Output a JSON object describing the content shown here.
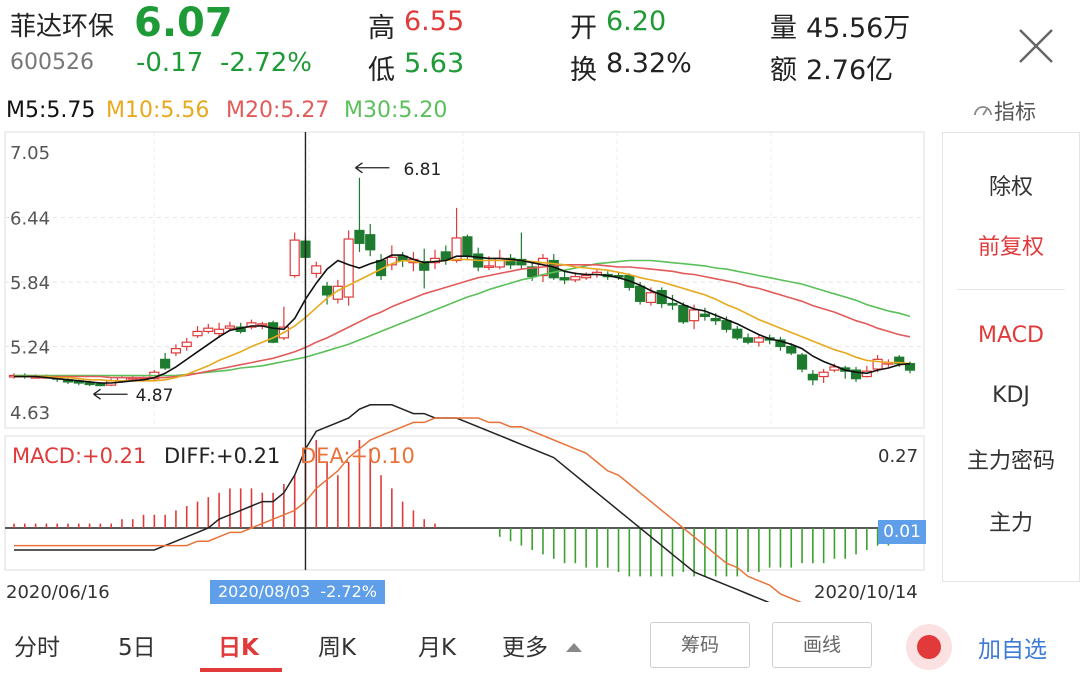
{
  "stock": {
    "name": "菲达环保",
    "code": "600526",
    "price": "6.07",
    "change": "-0.17",
    "change_pct": "-2.72%",
    "high_label": "高",
    "high": "6.55",
    "low_label": "低",
    "low": "5.63",
    "open_label": "开",
    "open": "6.20",
    "turnover_label": "换",
    "turnover": "8.32%",
    "volume_label": "量",
    "volume": "45.56万",
    "amount_label": "额",
    "amount": "2.76亿"
  },
  "ma": {
    "m5": "M5:5.75",
    "m10": "M10:5.56",
    "m20": "M20:5.27",
    "m30": "M30:5.20",
    "indicator_label": "指标"
  },
  "right_panel": {
    "items": [
      "除权",
      "前复权",
      "MACD",
      "KDJ",
      "主力密码",
      "主力"
    ],
    "active": [
      "前复权",
      "MACD"
    ]
  },
  "macd": {
    "macd_label": "MACD:+0.21",
    "diff_label": "DIFF:+0.21",
    "dea_label": "DEA:+0.10",
    "top_value": "0.27",
    "zero_badge": "0.01"
  },
  "dates": {
    "start": "2020/06/16",
    "end": "2020/10/14",
    "cursor_date": "2020/08/03",
    "cursor_pct": "-2.72%"
  },
  "bottom_tabs": [
    "分时",
    "5日",
    "日K",
    "周K",
    "月K",
    "更多"
  ],
  "bottom_active_tab": "日K",
  "bottom_buttons": {
    "chip": "筹码",
    "draw": "画线",
    "add": "加自选"
  },
  "colors": {
    "up": "#e03a3a",
    "down": "#1e7a2e",
    "ma5": "#111111",
    "ma10": "#e8a91e",
    "ma20": "#e25a5a",
    "ma30": "#5bc05a",
    "accent_blue": "#3d7ad6"
  },
  "chart_data": {
    "type": "candlestick",
    "y_ticks": [
      "7.05",
      "6.44",
      "5.84",
      "5.24",
      "4.63"
    ],
    "ylim": [
      4.63,
      7.05
    ],
    "max_annotation": "6.81",
    "min_annotation": "4.87",
    "candles": [
      [
        4.96,
        4.97,
        4.99,
        4.94
      ],
      [
        4.97,
        4.96,
        4.99,
        4.94
      ],
      [
        4.96,
        4.96,
        4.98,
        4.94
      ],
      [
        4.96,
        4.96,
        4.98,
        4.94
      ],
      [
        4.95,
        4.94,
        4.97,
        4.91
      ],
      [
        4.93,
        4.91,
        4.95,
        4.89
      ],
      [
        4.92,
        4.9,
        4.93,
        4.88
      ],
      [
        4.9,
        4.89,
        4.92,
        4.87
      ],
      [
        4.89,
        4.88,
        4.91,
        4.87
      ],
      [
        4.88,
        4.92,
        4.94,
        4.87
      ],
      [
        4.92,
        4.95,
        4.97,
        4.9
      ],
      [
        4.94,
        4.95,
        4.97,
        4.92
      ],
      [
        4.94,
        4.94,
        4.96,
        4.92
      ],
      [
        4.94,
        5.0,
        5.02,
        4.93
      ],
      [
        5.12,
        5.04,
        5.18,
        5.02
      ],
      [
        5.18,
        5.22,
        5.26,
        5.15
      ],
      [
        5.24,
        5.28,
        5.32,
        5.2
      ],
      [
        5.34,
        5.38,
        5.43,
        5.32
      ],
      [
        5.38,
        5.41,
        5.45,
        5.36
      ],
      [
        5.36,
        5.4,
        5.46,
        5.32
      ],
      [
        5.41,
        5.43,
        5.47,
        5.38
      ],
      [
        5.42,
        5.38,
        5.46,
        5.36
      ],
      [
        5.42,
        5.46,
        5.49,
        5.4
      ],
      [
        5.45,
        5.45,
        5.47,
        5.4
      ],
      [
        5.46,
        5.28,
        5.48,
        5.27
      ],
      [
        5.32,
        5.42,
        5.61,
        5.3
      ],
      [
        5.9,
        6.23,
        6.3,
        5.88
      ],
      [
        6.22,
        6.07,
        6.26,
        5.63
      ],
      [
        5.92,
        5.99,
        6.03,
        5.88
      ],
      [
        5.8,
        5.72,
        5.84,
        5.63
      ],
      [
        5.68,
        5.8,
        5.86,
        5.64
      ],
      [
        5.7,
        6.24,
        6.32,
        5.62
      ],
      [
        6.32,
        6.2,
        6.81,
        6.12
      ],
      [
        6.28,
        6.14,
        6.38,
        6.08
      ],
      [
        6.04,
        5.9,
        6.1,
        5.86
      ],
      [
        6.0,
        6.07,
        6.18,
        5.95
      ],
      [
        6.08,
        6.04,
        6.12,
        5.98
      ],
      [
        6.02,
        6.05,
        6.12,
        5.94
      ],
      [
        6.03,
        5.95,
        6.15,
        5.78
      ],
      [
        6.02,
        6.06,
        6.14,
        5.96
      ],
      [
        6.12,
        6.05,
        6.18,
        6.0
      ],
      [
        6.04,
        6.25,
        6.53,
        6.02
      ],
      [
        6.26,
        6.08,
        6.28,
        6.04
      ],
      [
        6.1,
        5.98,
        6.16,
        5.94
      ],
      [
        5.99,
        5.99,
        6.08,
        5.95
      ],
      [
        5.98,
        6.06,
        6.14,
        5.96
      ],
      [
        6.06,
        6.0,
        6.1,
        5.96
      ],
      [
        6.05,
        6.0,
        6.3,
        5.96
      ],
      [
        5.98,
        5.89,
        6.02,
        5.85
      ],
      [
        5.9,
        6.06,
        6.1,
        5.84
      ],
      [
        6.04,
        5.88,
        6.1,
        5.86
      ],
      [
        5.88,
        5.86,
        5.95,
        5.82
      ],
      [
        5.86,
        5.89,
        5.93,
        5.84
      ],
      [
        5.88,
        5.9,
        5.93,
        5.86
      ],
      [
        5.91,
        5.93,
        5.96,
        5.88
      ],
      [
        5.91,
        5.89,
        5.94,
        5.86
      ],
      [
        5.9,
        5.89,
        5.93,
        5.86
      ],
      [
        5.9,
        5.79,
        5.92,
        5.76
      ],
      [
        5.8,
        5.66,
        5.84,
        5.63
      ],
      [
        5.65,
        5.74,
        5.79,
        5.62
      ],
      [
        5.76,
        5.64,
        5.79,
        5.6
      ],
      [
        5.64,
        5.63,
        5.72,
        5.58
      ],
      [
        5.62,
        5.47,
        5.65,
        5.45
      ],
      [
        5.48,
        5.58,
        5.63,
        5.4
      ],
      [
        5.54,
        5.52,
        5.6,
        5.48
      ],
      [
        5.5,
        5.48,
        5.55,
        5.44
      ],
      [
        5.48,
        5.4,
        5.52,
        5.37
      ],
      [
        5.4,
        5.32,
        5.43,
        5.3
      ],
      [
        5.32,
        5.28,
        5.36,
        5.26
      ],
      [
        5.28,
        5.32,
        5.35,
        5.24
      ],
      [
        5.32,
        5.3,
        5.35,
        5.26
      ],
      [
        5.3,
        5.24,
        5.33,
        5.2
      ],
      [
        5.24,
        5.18,
        5.27,
        5.16
      ],
      [
        5.16,
        5.03,
        5.18,
        5.0
      ],
      [
        4.98,
        4.93,
        5.02,
        4.88
      ],
      [
        4.96,
        5.0,
        5.03,
        4.9
      ],
      [
        5.02,
        5.05,
        5.08,
        5.0
      ],
      [
        5.04,
        5.01,
        5.06,
        4.94
      ],
      [
        5.02,
        4.94,
        5.05,
        4.91
      ],
      [
        4.96,
        5.01,
        5.06,
        4.95
      ],
      [
        5.03,
        5.12,
        5.16,
        5.0
      ],
      [
        5.08,
        5.09,
        5.12,
        5.05
      ],
      [
        5.14,
        5.08,
        5.16,
        5.05
      ],
      [
        5.08,
        5.02,
        5.1,
        4.99
      ]
    ],
    "ma5": [
      4.96,
      4.96,
      4.96,
      4.95,
      4.94,
      4.93,
      4.92,
      4.91,
      4.9,
      4.9,
      4.91,
      4.92,
      4.93,
      4.95,
      4.99,
      5.05,
      5.12,
      5.19,
      5.26,
      5.33,
      5.39,
      5.41,
      5.43,
      5.43,
      5.41,
      5.4,
      5.5,
      5.68,
      5.83,
      5.96,
      6.04,
      6.0,
      5.97,
      6.01,
      6.04,
      6.09,
      6.09,
      6.05,
      6.02,
      6.03,
      6.04,
      6.08,
      6.08,
      6.07,
      6.06,
      6.06,
      6.05,
      6.04,
      6.02,
      6.0,
      5.98,
      5.94,
      5.92,
      5.91,
      5.91,
      5.9,
      5.88,
      5.85,
      5.81,
      5.76,
      5.72,
      5.68,
      5.63,
      5.59,
      5.57,
      5.53,
      5.49,
      5.45,
      5.4,
      5.35,
      5.31,
      5.29,
      5.26,
      5.22,
      5.15,
      5.1,
      5.06,
      5.02,
      5.0,
      4.99,
      5.02,
      5.04,
      5.07,
      5.08
    ],
    "ma10": [
      4.96,
      4.96,
      4.96,
      4.96,
      4.95,
      4.95,
      4.94,
      4.93,
      4.93,
      4.92,
      4.92,
      4.92,
      4.92,
      4.92,
      4.93,
      4.95,
      4.98,
      5.02,
      5.06,
      5.11,
      5.15,
      5.19,
      5.24,
      5.28,
      5.32,
      5.37,
      5.43,
      5.51,
      5.6,
      5.69,
      5.76,
      5.81,
      5.86,
      5.91,
      5.96,
      6.01,
      6.04,
      6.03,
      6.02,
      6.03,
      6.04,
      6.05,
      6.05,
      6.04,
      6.04,
      6.04,
      6.04,
      6.04,
      6.03,
      6.02,
      6.01,
      6.0,
      5.98,
      5.97,
      5.96,
      5.95,
      5.93,
      5.91,
      5.88,
      5.86,
      5.84,
      5.81,
      5.78,
      5.75,
      5.72,
      5.68,
      5.63,
      5.59,
      5.54,
      5.49,
      5.45,
      5.41,
      5.37,
      5.33,
      5.29,
      5.25,
      5.21,
      5.18,
      5.14,
      5.11,
      5.1,
      5.09,
      5.09,
      5.08
    ],
    "ma20": [
      4.96,
      4.96,
      4.96,
      4.96,
      4.96,
      4.96,
      4.96,
      4.96,
      4.96,
      4.95,
      4.95,
      4.95,
      4.95,
      4.95,
      4.95,
      4.96,
      4.97,
      4.99,
      5.01,
      5.03,
      5.05,
      5.07,
      5.09,
      5.11,
      5.13,
      5.16,
      5.19,
      5.23,
      5.28,
      5.32,
      5.37,
      5.42,
      5.47,
      5.52,
      5.56,
      5.61,
      5.65,
      5.69,
      5.73,
      5.76,
      5.79,
      5.82,
      5.85,
      5.88,
      5.9,
      5.92,
      5.94,
      5.96,
      5.97,
      5.98,
      5.99,
      6.0,
      6.0,
      6.0,
      6.0,
      5.99,
      5.98,
      5.98,
      5.97,
      5.96,
      5.95,
      5.94,
      5.92,
      5.91,
      5.89,
      5.87,
      5.85,
      5.83,
      5.8,
      5.78,
      5.75,
      5.72,
      5.69,
      5.66,
      5.62,
      5.59,
      5.56,
      5.52,
      5.48,
      5.45,
      5.41,
      5.38,
      5.35,
      5.33
    ],
    "ma30": [
      4.97,
      4.97,
      4.97,
      4.97,
      4.97,
      4.97,
      4.97,
      4.97,
      4.97,
      4.97,
      4.97,
      4.97,
      4.97,
      4.97,
      4.97,
      4.97,
      4.98,
      4.99,
      5.0,
      5.01,
      5.02,
      5.04,
      5.05,
      5.06,
      5.08,
      5.1,
      5.12,
      5.14,
      5.17,
      5.2,
      5.23,
      5.26,
      5.3,
      5.34,
      5.38,
      5.42,
      5.46,
      5.5,
      5.54,
      5.58,
      5.62,
      5.66,
      5.7,
      5.73,
      5.77,
      5.8,
      5.83,
      5.86,
      5.88,
      5.91,
      5.93,
      5.95,
      5.97,
      5.99,
      6.01,
      6.02,
      6.03,
      6.04,
      6.04,
      6.04,
      6.03,
      6.02,
      6.01,
      6.0,
      5.99,
      5.97,
      5.96,
      5.94,
      5.92,
      5.9,
      5.88,
      5.86,
      5.84,
      5.82,
      5.79,
      5.76,
      5.73,
      5.7,
      5.67,
      5.63,
      5.6,
      5.57,
      5.55,
      5.52
    ],
    "macd_hist": [
      0.01,
      0.01,
      0.01,
      0.01,
      0.01,
      0.01,
      0.01,
      0.01,
      0.01,
      0.01,
      0.02,
      0.02,
      0.03,
      0.03,
      0.03,
      0.04,
      0.05,
      0.06,
      0.07,
      0.08,
      0.09,
      0.09,
      0.09,
      0.08,
      0.08,
      0.1,
      0.12,
      0.18,
      0.2,
      0.15,
      0.12,
      0.15,
      0.2,
      0.18,
      0.12,
      0.09,
      0.06,
      0.04,
      0.02,
      0.01,
      0.0,
      0.0,
      0.0,
      0.0,
      0.0,
      -0.02,
      -0.03,
      -0.04,
      -0.05,
      -0.06,
      -0.07,
      -0.08,
      -0.08,
      -0.09,
      -0.09,
      -0.09,
      -0.1,
      -0.11,
      -0.11,
      -0.11,
      -0.11,
      -0.11,
      -0.1,
      -0.11,
      -0.11,
      -0.11,
      -0.11,
      -0.11,
      -0.1,
      -0.1,
      -0.09,
      -0.09,
      -0.09,
      -0.08,
      -0.08,
      -0.08,
      -0.07,
      -0.07,
      -0.06,
      -0.05,
      -0.04,
      -0.04,
      -0.03,
      -0.02
    ],
    "diff": [
      -0.05,
      -0.05,
      -0.05,
      -0.05,
      -0.05,
      -0.05,
      -0.05,
      -0.05,
      -0.05,
      -0.05,
      -0.05,
      -0.05,
      -0.05,
      -0.05,
      -0.04,
      -0.03,
      -0.02,
      -0.01,
      0.0,
      0.02,
      0.03,
      0.04,
      0.05,
      0.06,
      0.06,
      0.08,
      0.12,
      0.18,
      0.22,
      0.23,
      0.24,
      0.25,
      0.27,
      0.28,
      0.28,
      0.28,
      0.27,
      0.26,
      0.26,
      0.25,
      0.25,
      0.25,
      0.24,
      0.23,
      0.22,
      0.21,
      0.2,
      0.19,
      0.18,
      0.17,
      0.16,
      0.14,
      0.12,
      0.1,
      0.08,
      0.06,
      0.04,
      0.02,
      0.0,
      -0.02,
      -0.04,
      -0.06,
      -0.08,
      -0.1,
      -0.11,
      -0.12,
      -0.13,
      -0.14,
      -0.15,
      -0.16,
      -0.17,
      -0.18,
      -0.19,
      -0.2,
      -0.21,
      -0.22,
      -0.23,
      -0.24,
      -0.24,
      -0.24,
      -0.23,
      -0.23,
      -0.22,
      -0.21
    ],
    "dea": [
      -0.04,
      -0.04,
      -0.04,
      -0.04,
      -0.04,
      -0.04,
      -0.04,
      -0.04,
      -0.04,
      -0.04,
      -0.04,
      -0.04,
      -0.04,
      -0.04,
      -0.04,
      -0.04,
      -0.04,
      -0.03,
      -0.03,
      -0.02,
      -0.01,
      -0.01,
      0.0,
      0.01,
      0.02,
      0.03,
      0.04,
      0.06,
      0.09,
      0.11,
      0.13,
      0.16,
      0.18,
      0.2,
      0.21,
      0.22,
      0.23,
      0.24,
      0.24,
      0.25,
      0.25,
      0.25,
      0.25,
      0.25,
      0.24,
      0.24,
      0.23,
      0.23,
      0.22,
      0.21,
      0.2,
      0.19,
      0.18,
      0.17,
      0.15,
      0.13,
      0.12,
      0.1,
      0.08,
      0.06,
      0.04,
      0.02,
      0.0,
      -0.02,
      -0.04,
      -0.06,
      -0.08,
      -0.09,
      -0.11,
      -0.12,
      -0.13,
      -0.15,
      -0.16,
      -0.17,
      -0.18,
      -0.19,
      -0.2,
      -0.21,
      -0.22,
      -0.22,
      -0.23,
      -0.23,
      -0.22,
      -0.22
    ]
  }
}
